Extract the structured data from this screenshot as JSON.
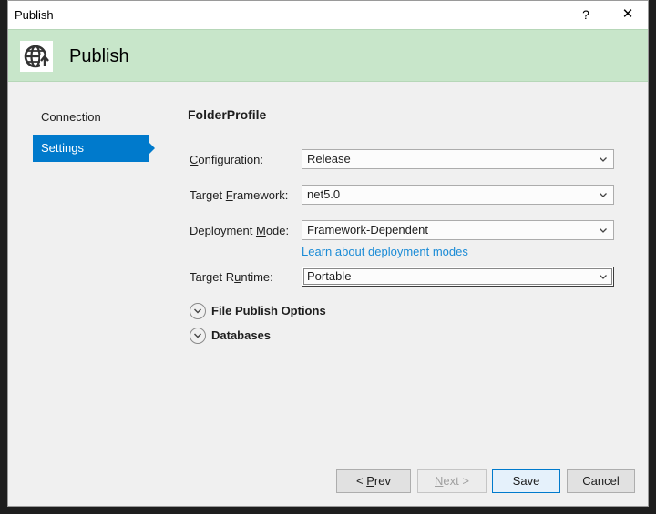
{
  "window": {
    "title": "Publish",
    "help_label": "?",
    "close_label": "✕"
  },
  "header": {
    "title": "Publish",
    "icon": "globe-publish-icon",
    "background": "#c8e6ca"
  },
  "nav": {
    "items": [
      {
        "label": "Connection",
        "selected": false
      },
      {
        "label": "Settings",
        "selected": true
      }
    ]
  },
  "profile": {
    "name": "FolderProfile"
  },
  "fields": {
    "configuration": {
      "label_pre": "",
      "label_key": "C",
      "label_post": "onfiguration:",
      "value": "Release"
    },
    "framework": {
      "label_pre": "Target ",
      "label_key": "F",
      "label_post": "ramework:",
      "value": "net5.0"
    },
    "deployment": {
      "label_pre": "Deployment ",
      "label_key": "M",
      "label_post": "ode:",
      "value": "Framework-Dependent"
    },
    "runtime": {
      "label_pre": "Target R",
      "label_key": "u",
      "label_post": "ntime:",
      "value": "Portable"
    }
  },
  "deployment_link": "Learn about deployment modes",
  "sections": [
    {
      "label": "File Publish Options"
    },
    {
      "label": "Databases"
    }
  ],
  "buttons": {
    "prev": {
      "pre": "< ",
      "key": "P",
      "post": "rev"
    },
    "next": {
      "pre": "",
      "key": "N",
      "post": "ext >"
    },
    "save": "Save",
    "cancel": "Cancel"
  },
  "colors": {
    "accent": "#007acc",
    "link": "#1a8bd6"
  }
}
